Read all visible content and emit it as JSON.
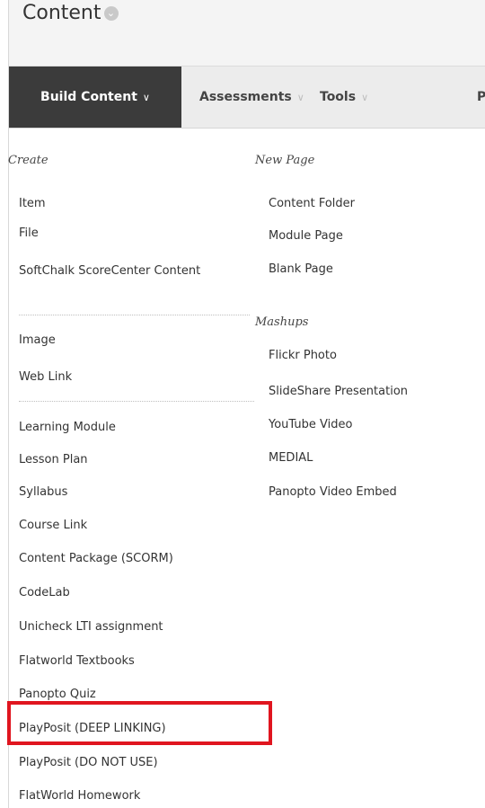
{
  "header": {
    "title": "Content"
  },
  "toolbar": {
    "tabs": [
      {
        "label": "Build Content"
      },
      {
        "label": "Assessments"
      },
      {
        "label": "Tools"
      },
      {
        "label": "P"
      }
    ]
  },
  "menu": {
    "left": {
      "create_title": "Create",
      "create_items": [
        "Item",
        "File",
        "SoftChalk ScoreCenter Content"
      ],
      "media_items": [
        "Image",
        "Web Link"
      ],
      "other_items": [
        "Learning Module",
        "Lesson Plan",
        "Syllabus",
        "Course Link",
        "Content Package (SCORM)",
        "CodeLab",
        "Unicheck LTI assignment",
        "Flatworld Textbooks",
        "Panopto Quiz",
        "PlayPosit (DEEP LINKING)",
        "PlayPosit (DO NOT USE)",
        "FlatWorld Homework"
      ]
    },
    "right": {
      "new_page_title": "New Page",
      "new_page_items": [
        "Content Folder",
        "Module Page",
        "Blank Page"
      ],
      "mashups_title": "Mashups",
      "mashups_items": [
        "Flickr Photo",
        "SlideShare Presentation",
        "YouTube Video",
        "MEDIAL",
        "Panopto Video Embed"
      ]
    }
  },
  "colors": {
    "highlight": "#e0151f",
    "active_tab": "#3b3b3b"
  }
}
